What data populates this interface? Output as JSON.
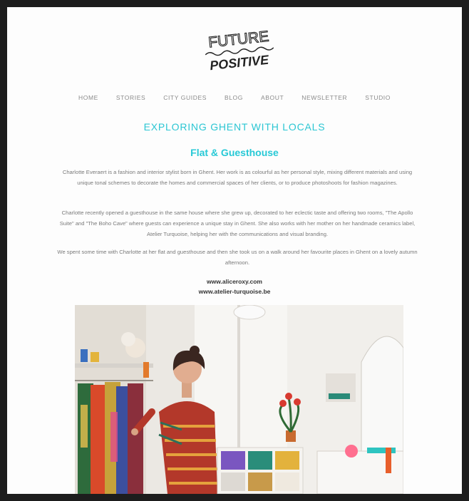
{
  "brand": {
    "line1": "FUTURE",
    "line2": "POSITIVE"
  },
  "nav": [
    "HOME",
    "STORIES",
    "CITY GUIDES",
    "BLOG",
    "ABOUT",
    "NEWSLETTER",
    "STUDIO"
  ],
  "headline": "EXPLORING GHENT WITH LOCALS",
  "subhead": "Flat & Guesthouse",
  "paragraphs": [
    "Charlotte Everaert is a fashion and interior stylist born in Ghent. Her work is as colourful as her personal style, mixing different materials and using unique tonal schemes to decorate the homes and commercial spaces of her clients, or to produce photoshoots for fashion magazines.",
    "Charlotte recently opened a guesthouse in the same house where she grew up, decorated to her eclectic taste and offering two rooms, \"The Apollo Suite\" and \"The Boho Cave\" where guests can experience a unique stay in Ghent. She also works with her mother on her handmade ceramics label, Atelier Turquoise, helping her with the communications and visual branding.",
    "We spent some time with Charlotte at her flat and guesthouse and then she took us on a walk around her favourite places in Ghent on a lovely autumn afternoon."
  ],
  "links": [
    "www.aliceroxy.com",
    "www.atelier-turquoise.be"
  ],
  "colors": {
    "accent": "#2bc6d3",
    "frame": "#1d1d1d",
    "page": "#fdfdfd"
  }
}
